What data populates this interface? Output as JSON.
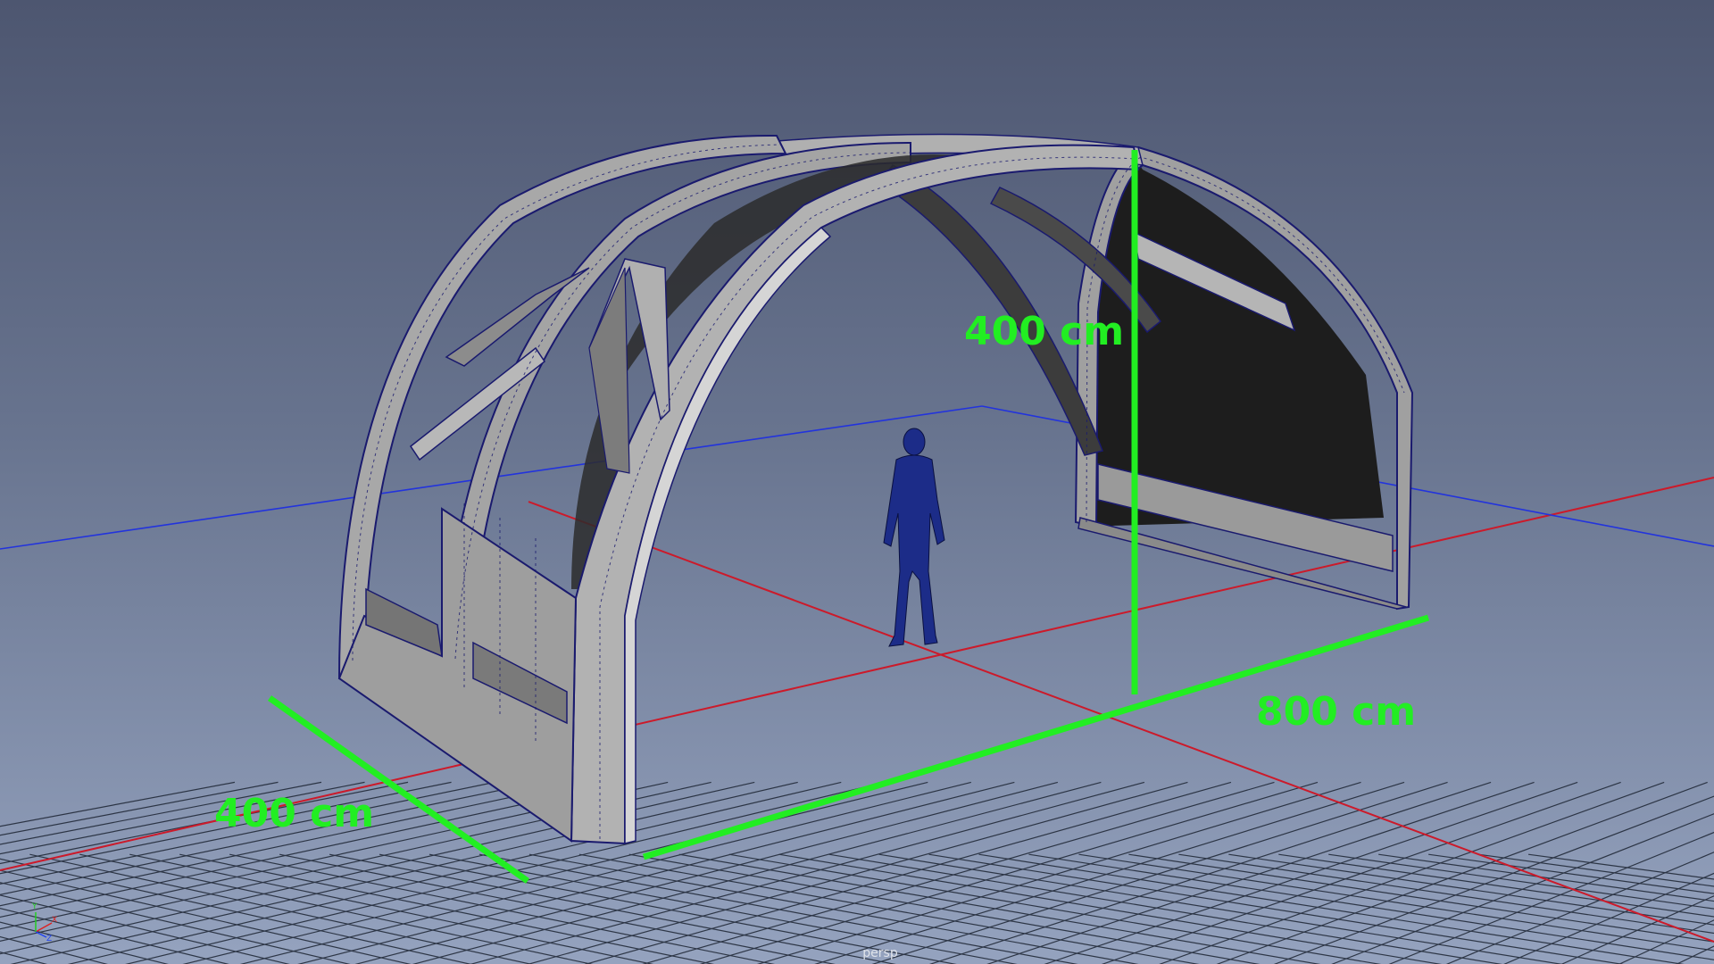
{
  "viewport": {
    "camera_name": "persp",
    "background_top": "#4d5670",
    "background_bottom": "#95a3bf",
    "grid_color": "#1c2432",
    "world_axis_x_color": "#cc1a2a",
    "world_axis_z_color": "#2233dd",
    "dimension_color": "#22ee22"
  },
  "dimensions": {
    "height_label": "400 cm",
    "length_label": "800 cm",
    "width_label": "400 cm"
  },
  "axis_gizmo": {
    "x": "X",
    "y": "Y",
    "z": "Z"
  },
  "icons": {
    "axis_gizmo": "xyz-axis-gizmo-icon",
    "human_reference": "human-scale-reference-figure"
  },
  "model": {
    "face_color": "#9b9b9b",
    "edge_color": "#1a1a6e",
    "figure_color": "#1c2c88"
  }
}
